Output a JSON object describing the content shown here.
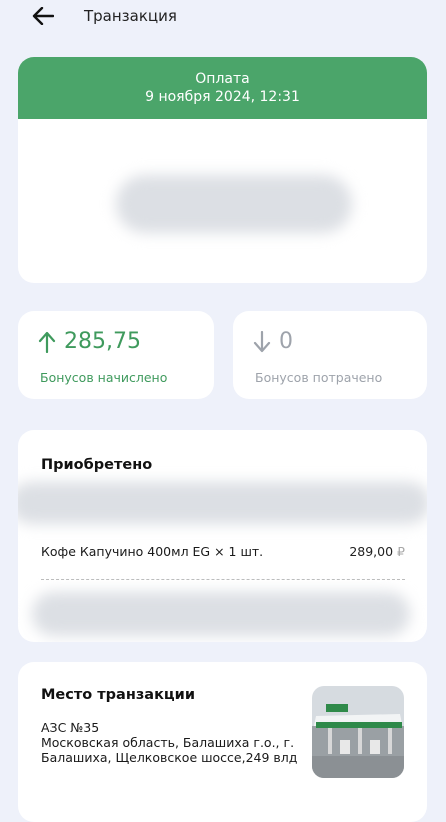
{
  "header": {
    "back_icon": "arrow-left-icon",
    "title": "Транзакция"
  },
  "transaction": {
    "type": "Оплата",
    "datetime": "9 ноября 2024, 12:31",
    "banner_color": "#4ba56a"
  },
  "bonuses": {
    "earned": {
      "icon": "arrow-up-icon",
      "value": "285,75",
      "label": "Бонусов начислено",
      "color": "#3f9a5d"
    },
    "spent": {
      "icon": "arrow-down-icon",
      "value": "0",
      "label": "Бонусов потрачено",
      "color": "#9ea3ab"
    }
  },
  "purchase": {
    "title": "Приобретено",
    "items": [
      {
        "name": "Кофе Капучино 400мл EG × 1 шт.",
        "price": "289,00",
        "currency": "₽"
      }
    ]
  },
  "place": {
    "title": "Место транзакции",
    "station": "АЗС №35",
    "address": "Московская область, Балашиха г.о., г. Балашиха, Щелковское шоссе,249 влд",
    "image_icon": "gas-station-photo"
  }
}
